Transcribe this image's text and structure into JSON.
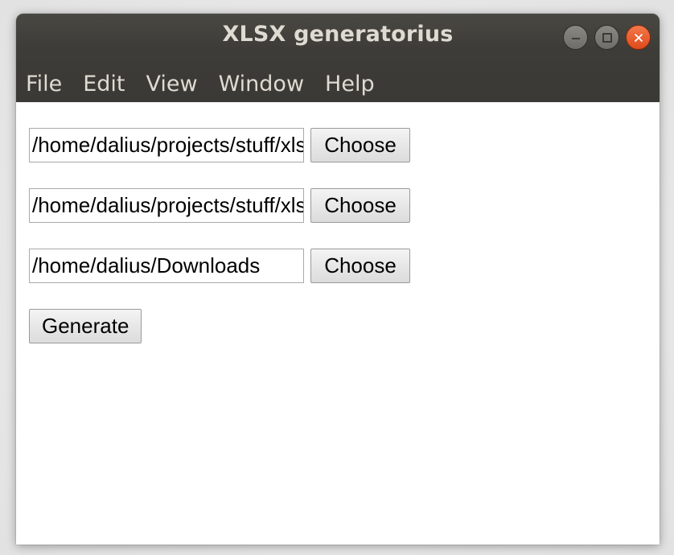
{
  "window": {
    "title": "XLSX generatorius"
  },
  "menubar": {
    "items": [
      "File",
      "Edit",
      "View",
      "Window",
      "Help"
    ]
  },
  "form": {
    "rows": [
      {
        "path": "/home/dalius/projects/stuff/xlsx",
        "button": "Choose"
      },
      {
        "path": "/home/dalius/projects/stuff/xlsx",
        "button": "Choose"
      },
      {
        "path": "/home/dalius/Downloads",
        "button": "Choose"
      }
    ],
    "generate_label": "Generate"
  },
  "icons": {
    "minimize": "minimize-icon",
    "maximize": "maximize-icon",
    "close": "close-icon"
  },
  "colors": {
    "titlebar": "#3e3c38",
    "close_button": "#e5531f",
    "title_text": "#dfdbd2"
  }
}
